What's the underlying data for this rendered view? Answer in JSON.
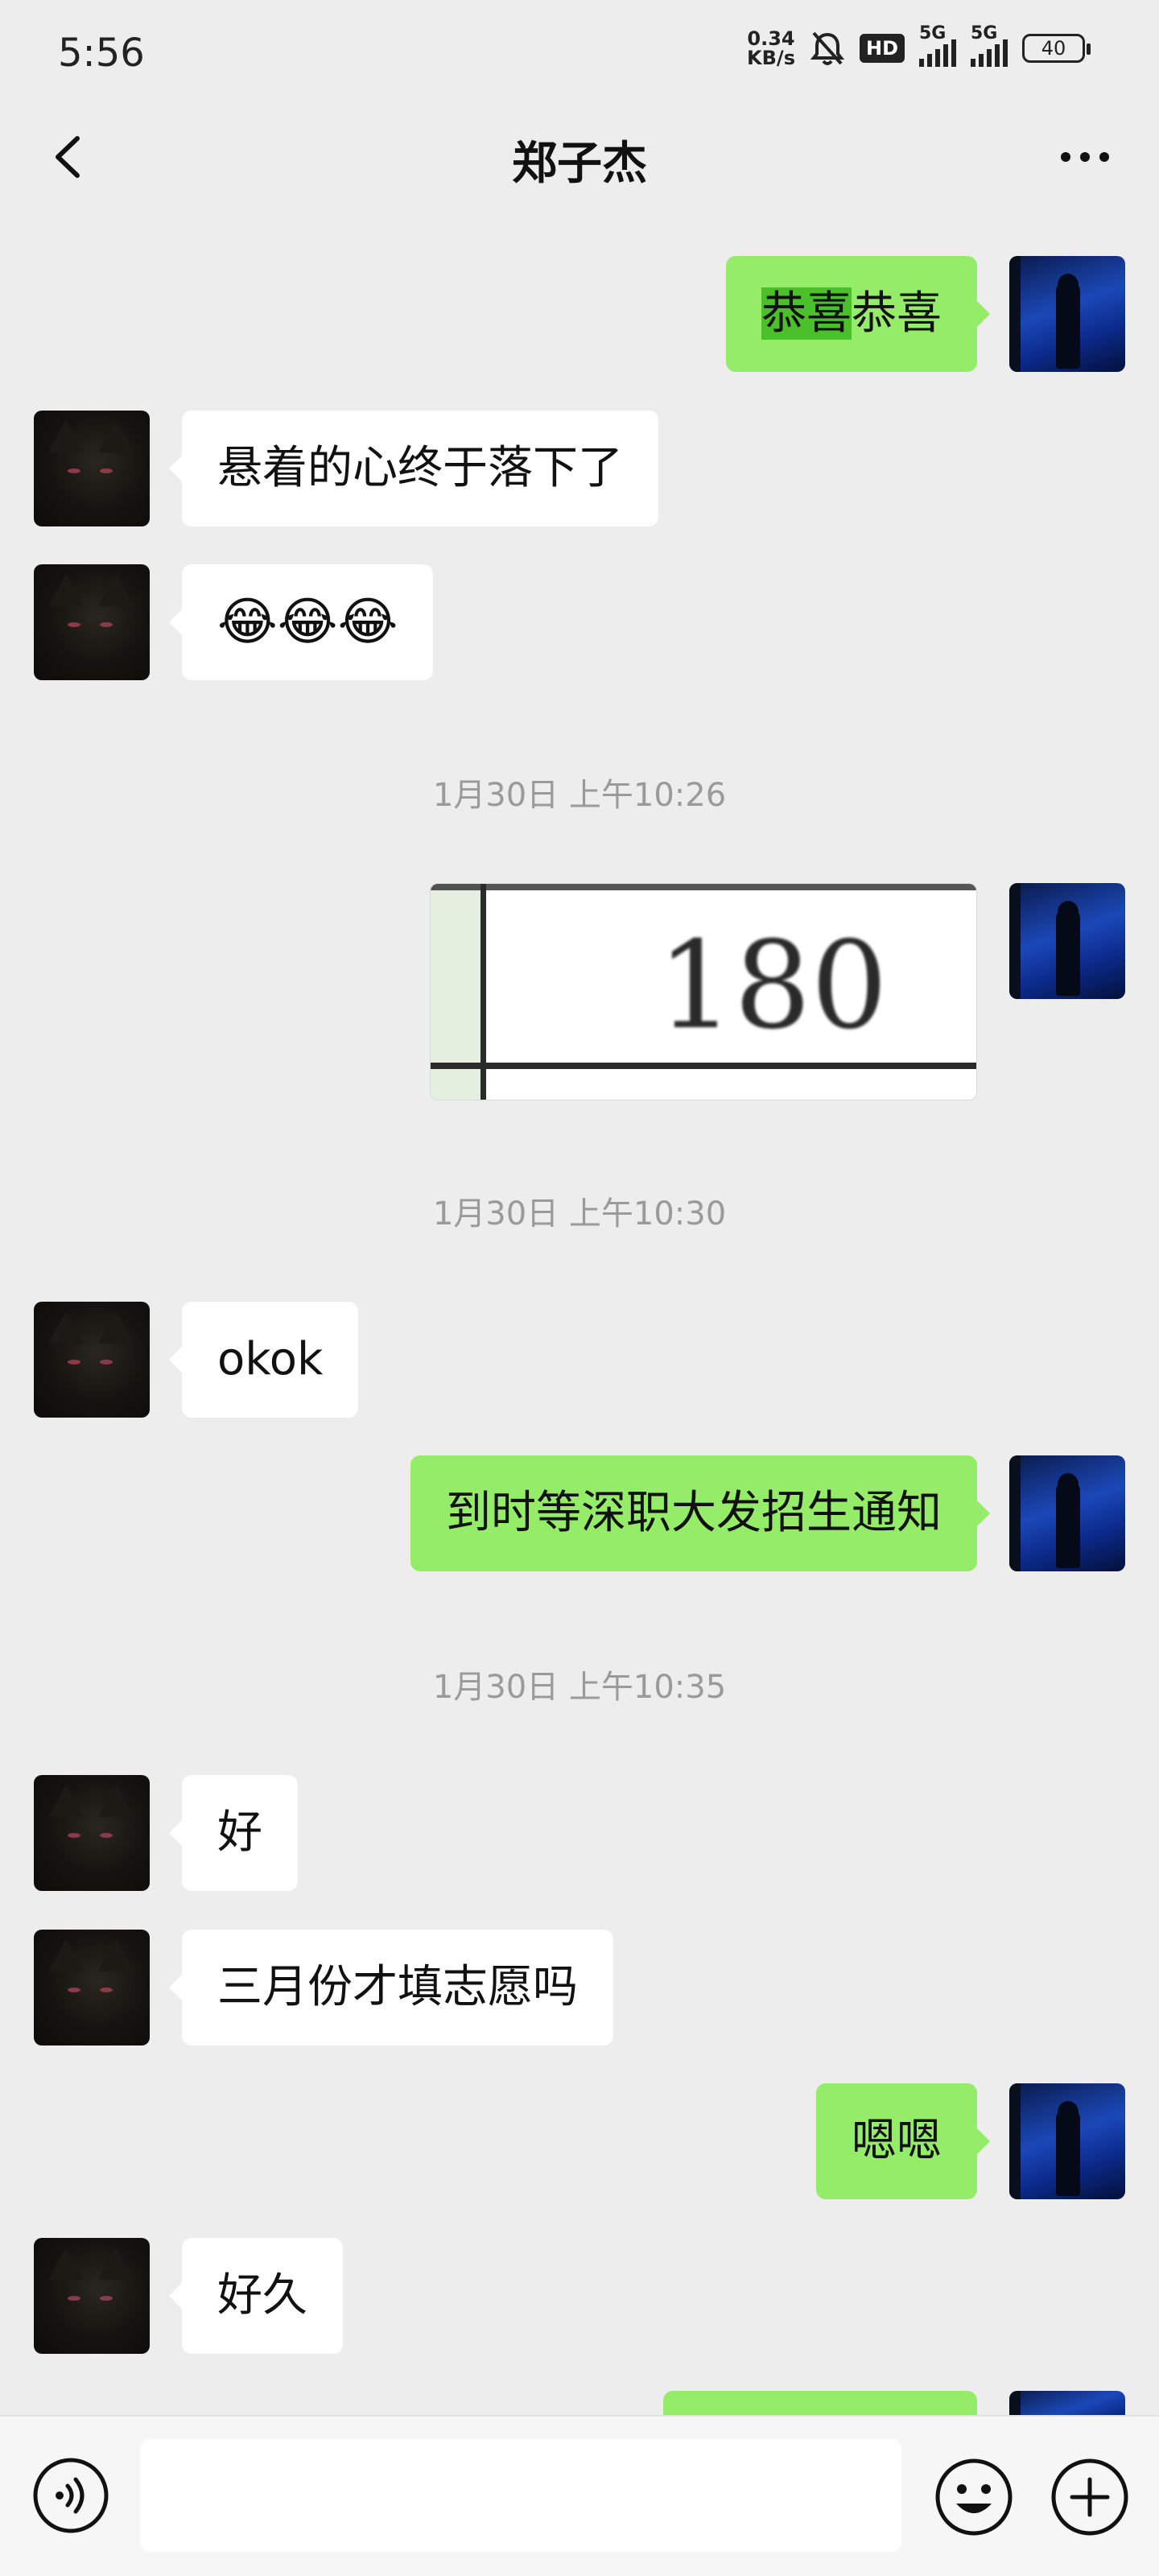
{
  "status_bar": {
    "time": "5:56",
    "net_speed_value": "0.34",
    "net_speed_unit": "KB/s",
    "hd_label": "HD",
    "signal1_label": "5G",
    "signal2_label": "5G",
    "battery": "40"
  },
  "header": {
    "title": "郑子杰"
  },
  "messages": [
    {
      "side": "right",
      "type": "text",
      "text_highlight": "恭喜",
      "text": "恭喜"
    },
    {
      "side": "left",
      "type": "text",
      "text": "悬着的心终于落下了"
    },
    {
      "side": "left",
      "type": "text",
      "text": "😂😂😂"
    },
    {
      "type": "timestamp",
      "text": "1月30日 上午10:26"
    },
    {
      "side": "right",
      "type": "image",
      "image_text": "180"
    },
    {
      "type": "timestamp",
      "text": "1月30日 上午10:30"
    },
    {
      "side": "left",
      "type": "text",
      "text": "okok"
    },
    {
      "side": "right",
      "type": "text",
      "text": "到时等深职大发招生通知"
    },
    {
      "type": "timestamp",
      "text": "1月30日 上午10:35"
    },
    {
      "side": "left",
      "type": "text",
      "text": "好"
    },
    {
      "side": "left",
      "type": "text",
      "text": "三月份才填志愿吗"
    },
    {
      "side": "right",
      "type": "text",
      "text": "嗯嗯"
    },
    {
      "side": "left",
      "type": "text",
      "text": "好久"
    }
  ],
  "input_bar": {
    "value": "",
    "voice_icon": "voice-icon",
    "emoji_icon": "emoji-icon",
    "plus_icon": "plus-icon"
  },
  "colors": {
    "background": "#ededed",
    "bubble_self": "#95ec69",
    "bubble_other": "#ffffff",
    "timestamp": "#9a9a9a",
    "highlight": "#4ac12a"
  }
}
